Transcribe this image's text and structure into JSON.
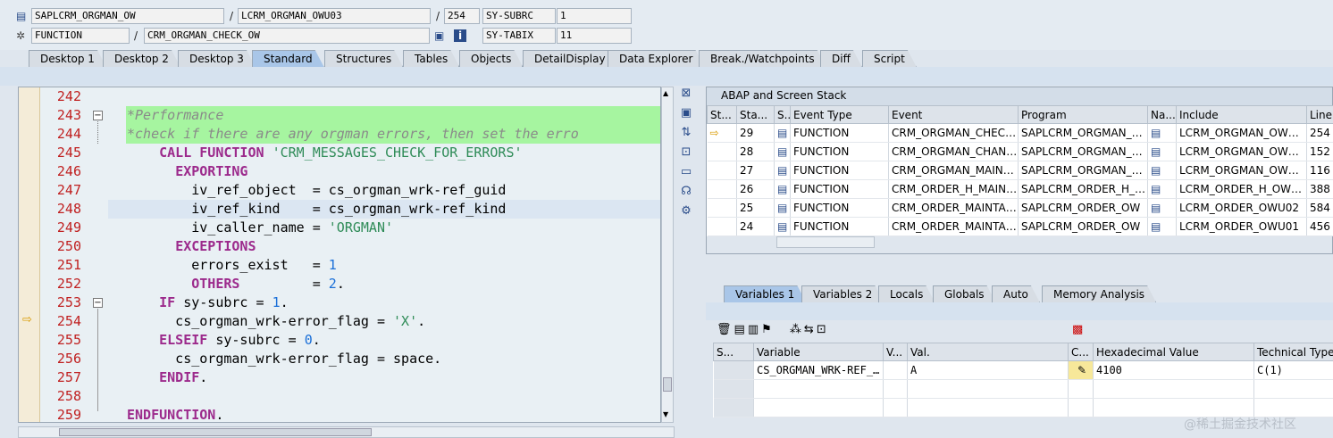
{
  "header": {
    "program": "SAPLCRM_ORGMAN_OW",
    "include": "LCRM_ORGMAN_OWU03",
    "line": "254",
    "subrc_label": "SY-SUBRC",
    "subrc_value": "1",
    "event_type": "FUNCTION",
    "event": "CRM_ORGMAN_CHECK_OW",
    "tabix_label": "SY-TABIX",
    "tabix_value": "11",
    "slash": "/"
  },
  "desktop_tabs": [
    "Desktop 1",
    "Desktop 2",
    "Desktop 3",
    "Standard",
    "Structures",
    "Tables",
    "Objects",
    "DetailDisplay",
    "Data Explorer",
    "Break./Watchpoints",
    "Diff",
    "Script"
  ],
  "active_tab": "Standard",
  "code_lines": [
    {
      "n": "242",
      "t": ""
    },
    {
      "n": "243",
      "t": "*Performance"
    },
    {
      "n": "244",
      "t": "*check if there are any orgman errors, then set the erro"
    },
    {
      "n": "245",
      "t": "    CALL FUNCTION 'CRM_MESSAGES_CHECK_FOR_ERRORS'"
    },
    {
      "n": "246",
      "t": "      EXPORTING"
    },
    {
      "n": "247",
      "t": "        iv_ref_object  = cs_orgman_wrk-ref_guid"
    },
    {
      "n": "248",
      "t": "        iv_ref_kind    = cs_orgman_wrk-ref_kind"
    },
    {
      "n": "249",
      "t": "        iv_caller_name = 'ORGMAN'"
    },
    {
      "n": "250",
      "t": "      EXCEPTIONS"
    },
    {
      "n": "251",
      "t": "        errors_exist   = 1"
    },
    {
      "n": "252",
      "t": "        OTHERS         = 2."
    },
    {
      "n": "253",
      "t": "    IF sy-subrc = 1."
    },
    {
      "n": "254",
      "t": "      cs_orgman_wrk-error_flag = 'X'."
    },
    {
      "n": "255",
      "t": "    ELSEIF sy-subrc = 0."
    },
    {
      "n": "256",
      "t": "      cs_orgman_wrk-error_flag = space."
    },
    {
      "n": "257",
      "t": "    ENDIF."
    },
    {
      "n": "258",
      "t": ""
    },
    {
      "n": "259",
      "t": "ENDFUNCTION."
    }
  ],
  "stack": {
    "title": "ABAP and Screen Stack",
    "columns": [
      "St...",
      "Sta...",
      "S...",
      "Event Type",
      "Event",
      "Program",
      "Na...",
      "Include",
      "Line"
    ],
    "rows": [
      {
        "sta": "29",
        "type": "FUNCTION",
        "event": "CRM_ORGMAN_CHECK_O...",
        "program": "SAPLCRM_ORGMAN_OW",
        "include": "LCRM_ORGMAN_OWU03",
        "line": "254"
      },
      {
        "sta": "28",
        "type": "FUNCTION",
        "event": "CRM_ORGMAN_CHANGE...",
        "program": "SAPLCRM_ORGMAN_OW",
        "include": "LCRM_ORGMAN_OWU01",
        "line": "152"
      },
      {
        "sta": "27",
        "type": "FUNCTION",
        "event": "CRM_ORGMAN_MAINTAI...",
        "program": "SAPLCRM_ORGMAN_OW",
        "include": "LCRM_ORGMAN_OWU05",
        "line": "116"
      },
      {
        "sta": "26",
        "type": "FUNCTION",
        "event": "CRM_ORDER_H_MAINTA...",
        "program": "SAPLCRM_ORDER_H_OW",
        "include": "LCRM_ORDER_H_OWU01",
        "line": "388"
      },
      {
        "sta": "25",
        "type": "FUNCTION",
        "event": "CRM_ORDER_MAINTAIN...",
        "program": "SAPLCRM_ORDER_OW",
        "include": "LCRM_ORDER_OWU02",
        "line": "584"
      },
      {
        "sta": "24",
        "type": "FUNCTION",
        "event": "CRM_ORDER_MAINTAIN...",
        "program": "SAPLCRM_ORDER_OW",
        "include": "LCRM_ORDER_OWU01",
        "line": "456"
      }
    ]
  },
  "var_tabs": [
    "Variables 1",
    "Variables 2",
    "Locals",
    "Globals",
    "Auto",
    "Memory Analysis"
  ],
  "variables": {
    "columns": [
      "S...",
      "Variable",
      "V...",
      "Val.",
      "C...",
      "Hexadecimal Value",
      "Technical Type"
    ],
    "rows": [
      {
        "variable": "CS_ORGMAN_WRK-REF_K...",
        "val": "A",
        "hex": "4100",
        "type": "C(1)"
      }
    ]
  },
  "watermark": "@稀土掘金技术社区",
  "colors": {
    "accent": "#a9c6e8",
    "keyword": "#9c2a8c",
    "string": "#2e8b57",
    "number": "#1a6fd8",
    "comment_hl": "#a6f5a0"
  }
}
